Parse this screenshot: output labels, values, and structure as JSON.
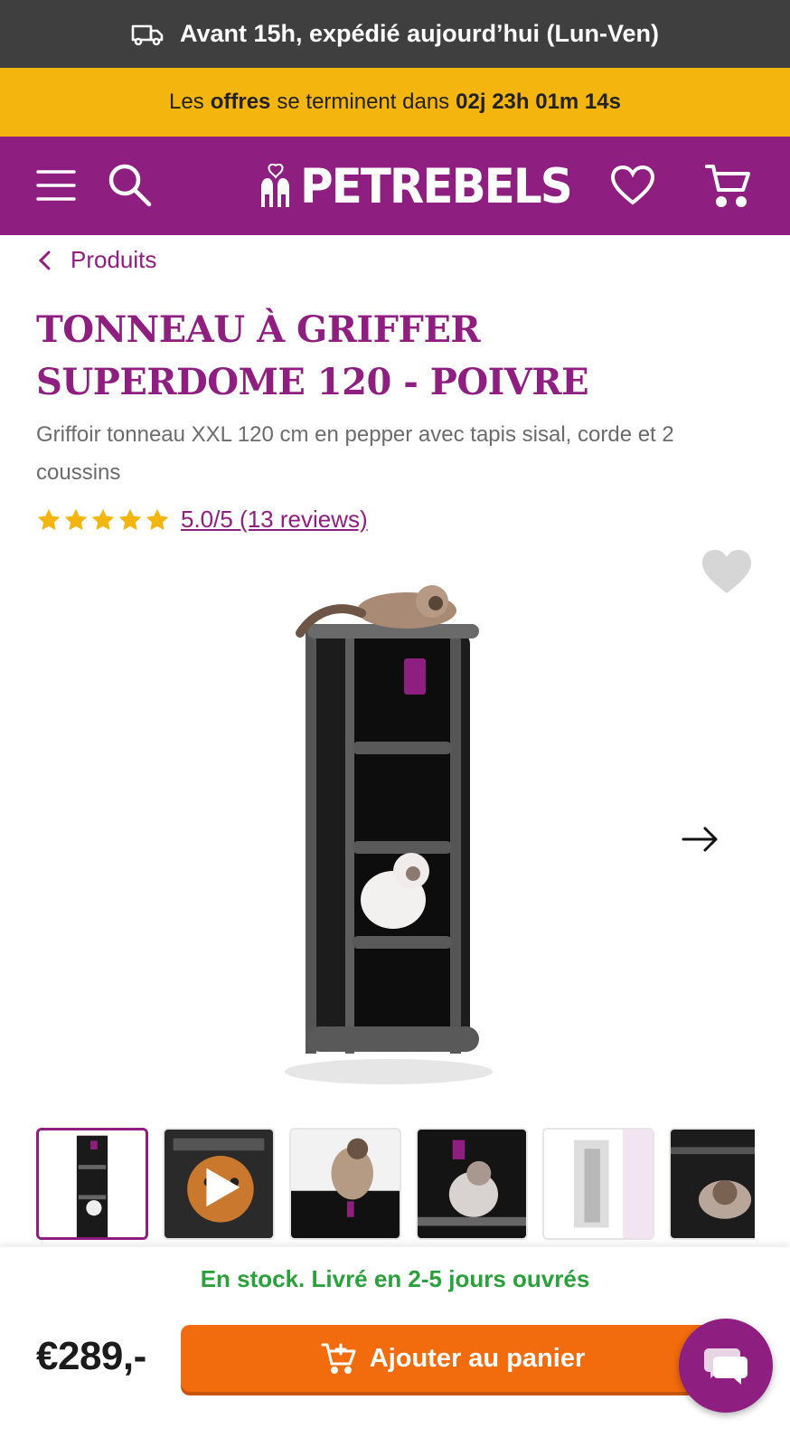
{
  "shipping_bar": {
    "text": "Avant 15h, expédié aujourd’hui (Lun-Ven)",
    "icon": "truck-icon"
  },
  "offer_bar": {
    "prefix": "Les",
    "highlight": "offres",
    "middle": "se terminent dans",
    "countdown": "02j 23h 01m 14s"
  },
  "header": {
    "brand": "PETREBELS",
    "icons": [
      "menu-icon",
      "search-icon",
      "heart-icon",
      "cart-icon"
    ]
  },
  "breadcrumb": {
    "label": "Produits"
  },
  "product": {
    "title": "TONNEAU À GRIFFER SUPERDOME 120 - POIVRE",
    "subtitle": "Griffoir tonneau XXL 120 cm en pepper avec tapis sisal, corde et 2 coussins",
    "rating_text": "5.0/5 (13 reviews)",
    "rating": 5,
    "rating_max": 5,
    "tag_brand": "PETREBELS"
  },
  "bottom_bar": {
    "stock": "En stock. Livré en 2-5 jours ouvrés",
    "price": "€289,-",
    "cart_label": "Ajouter au panier"
  },
  "colors": {
    "brand": "#8e1f80",
    "offer": "#f5b50f",
    "cta": "#f26b0c",
    "stock": "#2aa13a",
    "star": "#f5b50f"
  }
}
